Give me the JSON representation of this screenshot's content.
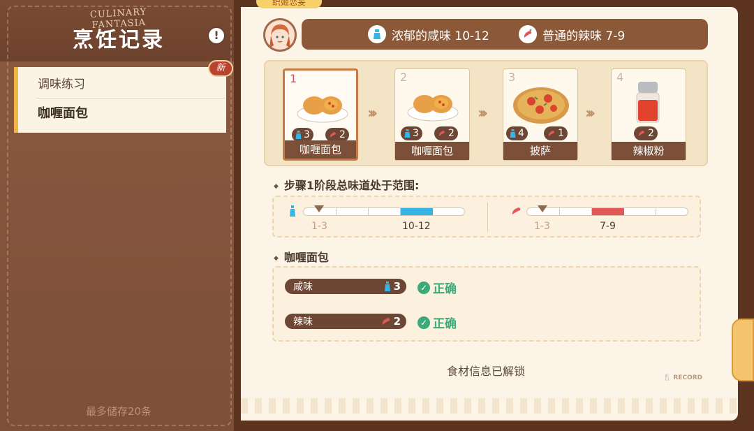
{
  "left_panel": {
    "brand": "CULINARY FANTASIA",
    "title": "烹饪记录",
    "info_icon": "exclamation-icon",
    "items": [
      {
        "label": "调味练习"
      },
      {
        "label": "咖喱面包"
      }
    ],
    "new_badge": "新",
    "storage_note": "最多储存20条"
  },
  "character": {
    "name": "织姬恋妄"
  },
  "flavor_targets": [
    {
      "icon": "salt-shaker-icon",
      "text": "浓郁的咸味 10-12"
    },
    {
      "icon": "chili-icon",
      "text": "普通的辣味 7-9"
    }
  ],
  "steps": [
    {
      "num": "1",
      "label": "咖喱面包",
      "salt": "3",
      "spicy": "2",
      "active": true
    },
    {
      "num": "2",
      "label": "咖喱面包",
      "salt": "3",
      "spicy": "2"
    },
    {
      "num": "3",
      "label": "披萨",
      "salt": "4",
      "spicy": "1"
    },
    {
      "num": "4",
      "label": "辣椒粉",
      "spicy": "2"
    }
  ],
  "range_section": {
    "title": "步骤1阶段总味道处于范围:",
    "salt": {
      "current": "1-3",
      "target": "10-12"
    },
    "spicy": {
      "current": "1-3",
      "target": "7-9"
    }
  },
  "detail_section": {
    "title": "咖喱面包",
    "rows": [
      {
        "name": "咸味",
        "value": "3",
        "status": "正确"
      },
      {
        "name": "辣味",
        "value": "2",
        "status": "正确"
      }
    ]
  },
  "unlock_text": "食材信息已解锁",
  "watermark": "RECORD",
  "colors": {
    "salt": "#35b4e6",
    "spicy": "#e25757",
    "correct": "#3caa78"
  }
}
